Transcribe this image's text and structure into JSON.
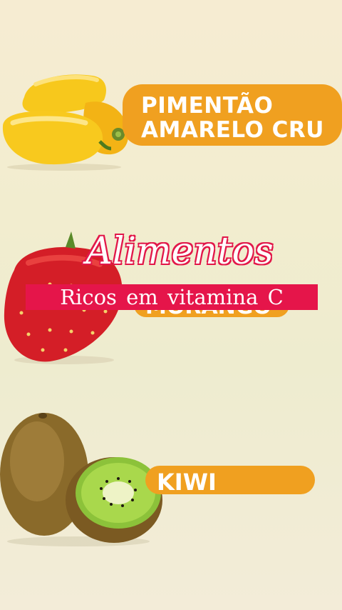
{
  "items": {
    "pepper": {
      "line1": "PIMENTÃO",
      "line2": "AMARELO CRU"
    },
    "strawberry": {
      "label": "MORANGO"
    },
    "kiwi": {
      "label": "KIWI"
    }
  },
  "overlay": {
    "title": "Alimentos",
    "subtitle": "Ricos em vitamina C"
  },
  "colors": {
    "pill": "#f0a020",
    "accent": "#e5154a",
    "background": "#f2edcf"
  }
}
